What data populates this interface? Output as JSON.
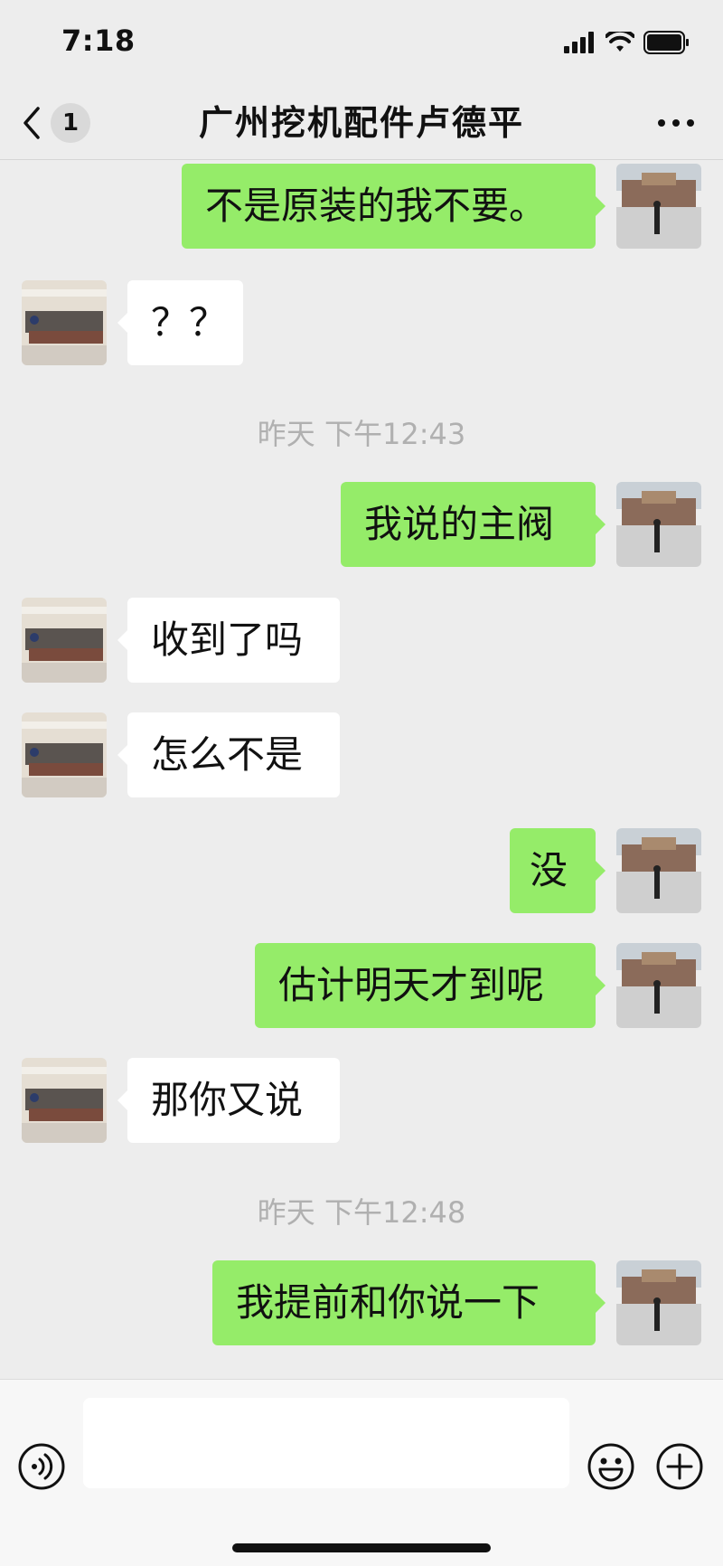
{
  "status_bar": {
    "time": "7:18"
  },
  "nav": {
    "back_count": "1",
    "title": "广州挖机配件卢德平"
  },
  "messages": [
    {
      "sender": "self",
      "text": "不是原装的我不要。"
    },
    {
      "sender": "other",
      "text": "？？"
    },
    {
      "type": "timestamp",
      "text": "昨天 下午12:43"
    },
    {
      "sender": "self",
      "text": "我说的主阀"
    },
    {
      "sender": "other",
      "text": "收到了吗"
    },
    {
      "sender": "other",
      "text": "怎么不是"
    },
    {
      "sender": "self",
      "text": "没"
    },
    {
      "sender": "self",
      "text": "估计明天才到呢"
    },
    {
      "sender": "other",
      "text": "那你又说"
    },
    {
      "type": "timestamp",
      "text": "昨天 下午12:48"
    },
    {
      "sender": "self",
      "text": "我提前和你说一下"
    }
  ],
  "input_bar": {
    "text_value": ""
  },
  "icons": {
    "back": "chevron-left-icon",
    "more": "more-dots-icon",
    "voice": "voice-icon",
    "emoji": "emoji-icon",
    "plus": "plus-icon"
  },
  "colors": {
    "self_bubble": "#95ec69",
    "other_bubble": "#ffffff",
    "background": "#ededed"
  }
}
